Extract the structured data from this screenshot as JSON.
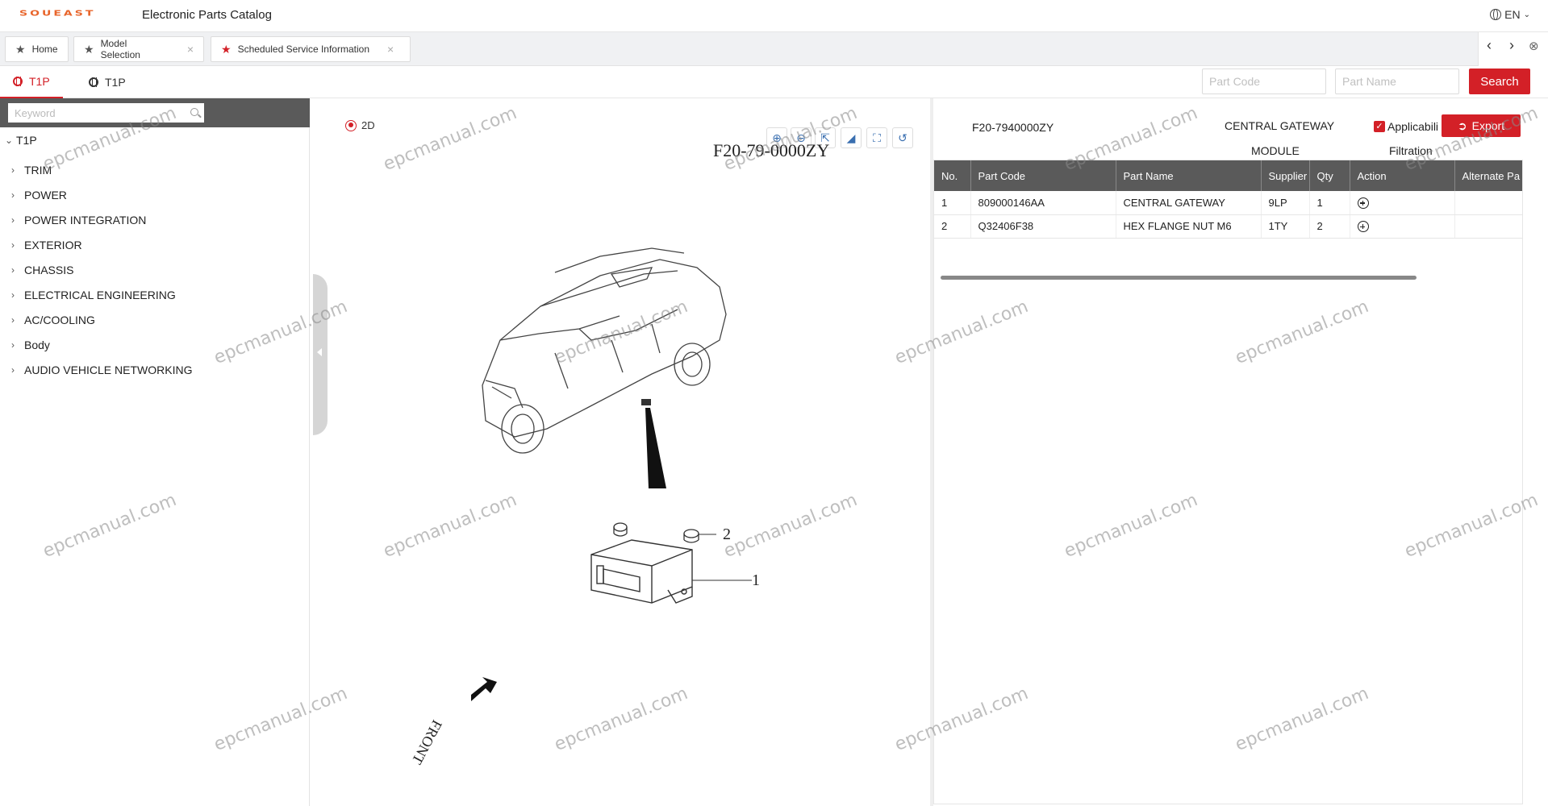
{
  "header": {
    "logo_text": "SOUEAST",
    "app_title": "Electronic Parts Catalog",
    "language": "EN"
  },
  "tabs": [
    {
      "label": "Home",
      "closable": false
    },
    {
      "label": "Model Selection",
      "closable": true
    },
    {
      "label": "Scheduled Service Information",
      "closable": true,
      "active": true
    }
  ],
  "model_tabs": [
    {
      "label": "T1P",
      "active": true
    },
    {
      "label": "T1P",
      "active": false
    }
  ],
  "search": {
    "part_code_placeholder": "Part Code",
    "part_name_placeholder": "Part Name",
    "button_label": "Search"
  },
  "sidebar": {
    "keyword_placeholder": "Keyword",
    "root_label": "T1P",
    "items": [
      {
        "label": "TRIM"
      },
      {
        "label": "POWER"
      },
      {
        "label": "POWER INTEGRATION"
      },
      {
        "label": "EXTERIOR"
      },
      {
        "label": "CHASSIS"
      },
      {
        "label": "ELECTRICAL ENGINEERING"
      },
      {
        "label": "AC/COOLING"
      },
      {
        "label": "Body"
      },
      {
        "label": "AUDIO VEHICLE NETWORKING"
      }
    ]
  },
  "diagram": {
    "view_mode": "2D",
    "figure_code": "F20-79-0000ZY",
    "callouts": [
      "1",
      "2"
    ],
    "front_label": "FRONT"
  },
  "parts_panel": {
    "assembly_code": "F20-7940000ZY",
    "assembly_name": "CENTRAL GATEWAY",
    "assembly_name_line2": "MODULE",
    "applicability_label": "Applicabili",
    "filtration_label": "Filtration",
    "export_label": "Export",
    "columns": [
      "No.",
      "Part Code",
      "Part Name",
      "Supplier",
      "Qty",
      "Action",
      "Alternate Pa"
    ],
    "rows": [
      {
        "no": "1",
        "part_code": "809000146AA",
        "part_name": "CENTRAL GATEWAY",
        "supplier": "9LP",
        "qty": "1"
      },
      {
        "no": "2",
        "part_code": "Q32406F38",
        "part_name": "HEX FLANGE NUT M6",
        "supplier": "1TY",
        "qty": "2"
      }
    ]
  },
  "watermark_text": "epcmanual.com",
  "colors": {
    "brand_red": "#d32027",
    "logo_orange": "#e8642a",
    "header_gray": "#5a5a5a"
  }
}
